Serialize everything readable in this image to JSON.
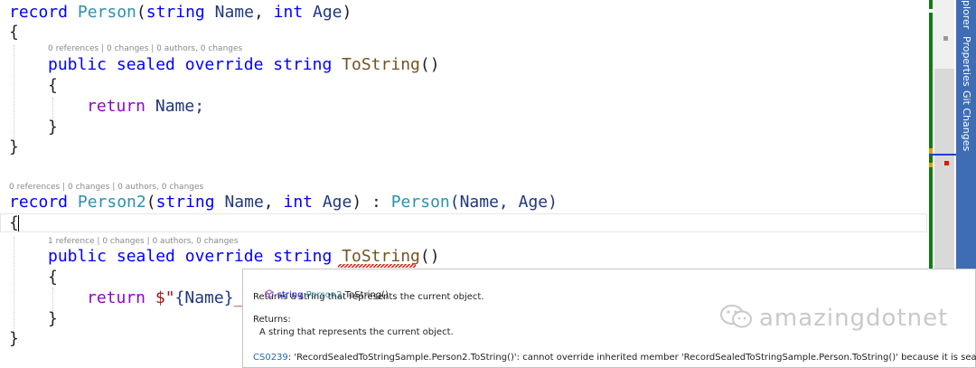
{
  "code": {
    "l1": {
      "kw_record": "record",
      "type_name": "Person",
      "open": "(",
      "p1_type": "string",
      "p1_name": " Name",
      "comma": ", ",
      "p2_type": "int",
      "p2_name": " Age",
      "close": ")"
    },
    "l2": "{",
    "lens1": "0 references | 0 changes | 0 authors, 0 changes",
    "l3": {
      "kw1": "public",
      "kw2": "sealed",
      "kw3": "override",
      "kw4": "string",
      "method": "ToString",
      "parens": "()"
    },
    "l4": "{",
    "l5": {
      "kw": "return",
      "rest": " Name;"
    },
    "l6": "}",
    "l7": "}",
    "lens2": "0 references | 0 changes | 0 authors, 0 changes",
    "l8": {
      "kw_record": "record",
      "type_name": "Person2",
      "open": "(",
      "p1_type": "string",
      "p1_name": " Name",
      "comma": ", ",
      "p2_type": "int",
      "p2_name": " Age",
      "mid": ") : ",
      "base": "Person",
      "base_args": "(Name, Age)"
    },
    "l9": "{",
    "lens3": "1 reference | 0 changes | 0 authors, 0 changes",
    "l10": {
      "kw1": "public",
      "kw2": "sealed",
      "kw3": "override",
      "kw4": "string",
      "method": "ToString",
      "parens": "()"
    },
    "l11": "{",
    "l12": {
      "kw": "return",
      "str_start": " $\"",
      "interp": "{Name}",
      "tail": "_"
    },
    "l13": "}",
    "l14": "}"
  },
  "tooltip": {
    "sig_kw": "string",
    "sig_type": "Person2",
    "sig_method": ".ToString()",
    "summary": "Returns a string that represents the current object.",
    "returns_label": "Returns:",
    "returns_text": "A string that represents the current object.",
    "error_code": "CS0239",
    "error_text": ": 'RecordSealedToStringSample.Person2.ToString()': cannot override inherited member 'RecordSealedToStringSample.Person.ToString()' because it is sealed"
  },
  "side_tabs": [
    "plorer",
    "Properties",
    "Git Changes"
  ],
  "watermark": "amazingdotnet",
  "colors": {
    "keyword": "#0000ff",
    "control": "#8f08c4",
    "type": "#2b91af",
    "method": "#74531f",
    "error": "#e51400",
    "tab_bar": "#3e6db5",
    "margin_change": "#107c10"
  },
  "icons": [
    "cube-icon",
    "wechat-icon"
  ]
}
